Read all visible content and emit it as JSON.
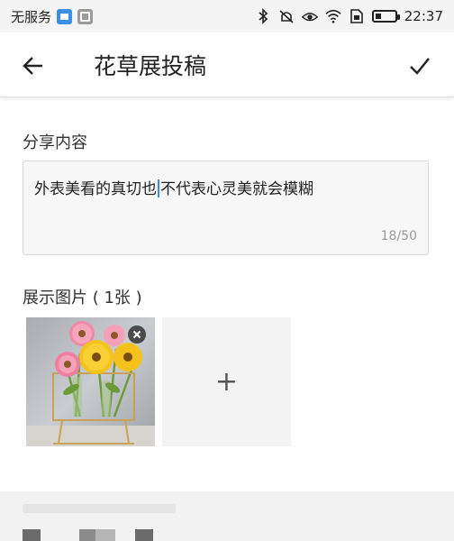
{
  "status_bar": {
    "carrier": "无服务",
    "time": "22:37",
    "battery_level": 0.3,
    "icons": [
      "notification-blue-icon",
      "notification-gray-icon",
      "bluetooth-icon",
      "mute-icon",
      "eye-icon",
      "wifi-icon",
      "sim-icon",
      "battery-icon"
    ]
  },
  "app_bar": {
    "title": "花草展投稿",
    "back_icon": "arrow-left-icon",
    "confirm_icon": "check-icon"
  },
  "share_section": {
    "label": "分享内容",
    "text_before_cursor": "外表美看的真切也",
    "text_after_cursor": "不代表心灵美就会模糊",
    "char_count": "18/50"
  },
  "images_section": {
    "label": "展示图片 ( 1张 )",
    "images": [
      {
        "name": "flower-vase-photo",
        "remove_icon": "close-icon"
      }
    ],
    "add_label": "+"
  },
  "colors": {
    "accent": "#3d8fd8",
    "text": "#222222",
    "muted": "#999999"
  }
}
